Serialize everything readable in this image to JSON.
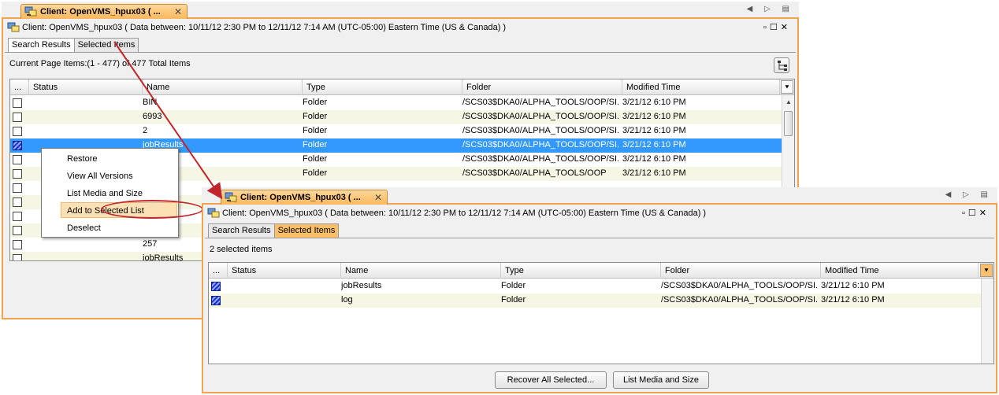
{
  "back_panel": {
    "tab_title": "Client: OpenVMS_hpux03 ( ...",
    "title": "Client: OpenVMS_hpux03 ( Data between: 10/11/12 2:30 PM to 12/11/12 7:14 AM (UTC-05:00) Eastern Time (US & Canada) )",
    "subtabs": [
      "Search Results",
      "Selected Items"
    ],
    "count_label": "Current Page Items:(1 - 477) of 477 Total Items",
    "columns": [
      "...",
      "Status",
      "Name",
      "Type",
      "Folder",
      "Modified Time"
    ],
    "rows": [
      {
        "name": "BIN",
        "type": "Folder",
        "folder": "/SCS03$DKA0/ALPHA_TOOLS/OOP/SI...",
        "modified": "3/21/12 6:10 PM"
      },
      {
        "name": "6993",
        "type": "Folder",
        "folder": "/SCS03$DKA0/ALPHA_TOOLS/OOP/SI...",
        "modified": "3/21/12 6:10 PM"
      },
      {
        "name": "2",
        "type": "Folder",
        "folder": "/SCS03$DKA0/ALPHA_TOOLS/OOP/SI...",
        "modified": "3/21/12 6:10 PM"
      },
      {
        "name": "jobResults",
        "type": "Folder",
        "folder": "/SCS03$DKA0/ALPHA_TOOLS/OOP/SI...",
        "modified": "3/21/12 6:10 PM"
      },
      {
        "name": "",
        "type": "Folder",
        "folder": "/SCS03$DKA0/ALPHA_TOOLS/OOP/SI...",
        "modified": "3/21/12 6:10 PM"
      },
      {
        "name": "",
        "type": "Folder",
        "folder": "/SCS03$DKA0/ALPHA_TOOLS/OOP",
        "modified": "3/21/12 6:10 PM"
      },
      {
        "name": "",
        "type": "",
        "folder": "",
        "modified": ""
      },
      {
        "name": "OOLS",
        "type": "",
        "folder": "",
        "modified": ""
      },
      {
        "name": "",
        "type": "",
        "folder": "",
        "modified": ""
      },
      {
        "name": "",
        "type": "",
        "folder": "",
        "modified": ""
      },
      {
        "name": "257",
        "type": "",
        "folder": "",
        "modified": ""
      },
      {
        "name": "jobResults",
        "type": "",
        "folder": "",
        "modified": ""
      }
    ]
  },
  "context_menu": {
    "items": [
      "Restore",
      "View All Versions",
      "List Media and Size",
      "Add to Selected List",
      "Deselect"
    ]
  },
  "front_panel": {
    "tab_title": "Client: OpenVMS_hpux03 ( ...",
    "title": "Client: OpenVMS_hpux03 ( Data between: 10/11/12 2:30 PM to 12/11/12 7:14 AM (UTC-05:00) Eastern Time (US & Canada) )",
    "subtabs": [
      "Search Results",
      "Selected Items"
    ],
    "count_label": "2 selected items",
    "columns": [
      "...",
      "Status",
      "Name",
      "Type",
      "Folder",
      "Modified Time"
    ],
    "rows": [
      {
        "name": "jobResults",
        "type": "Folder",
        "folder": "/SCS03$DKA0/ALPHA_TOOLS/OOP/SI...",
        "modified": "3/21/12 6:10 PM"
      },
      {
        "name": "log",
        "type": "Folder",
        "folder": "/SCS03$DKA0/ALPHA_TOOLS/OOP/SI...",
        "modified": "3/21/12 6:10 PM"
      }
    ],
    "buttons": {
      "recover": "Recover All Selected...",
      "list_media": "List Media and Size"
    }
  },
  "colors": {
    "accent_orange": "#f2a34b",
    "selection_blue": "#3399ff",
    "callout_red": "#c0262c"
  }
}
